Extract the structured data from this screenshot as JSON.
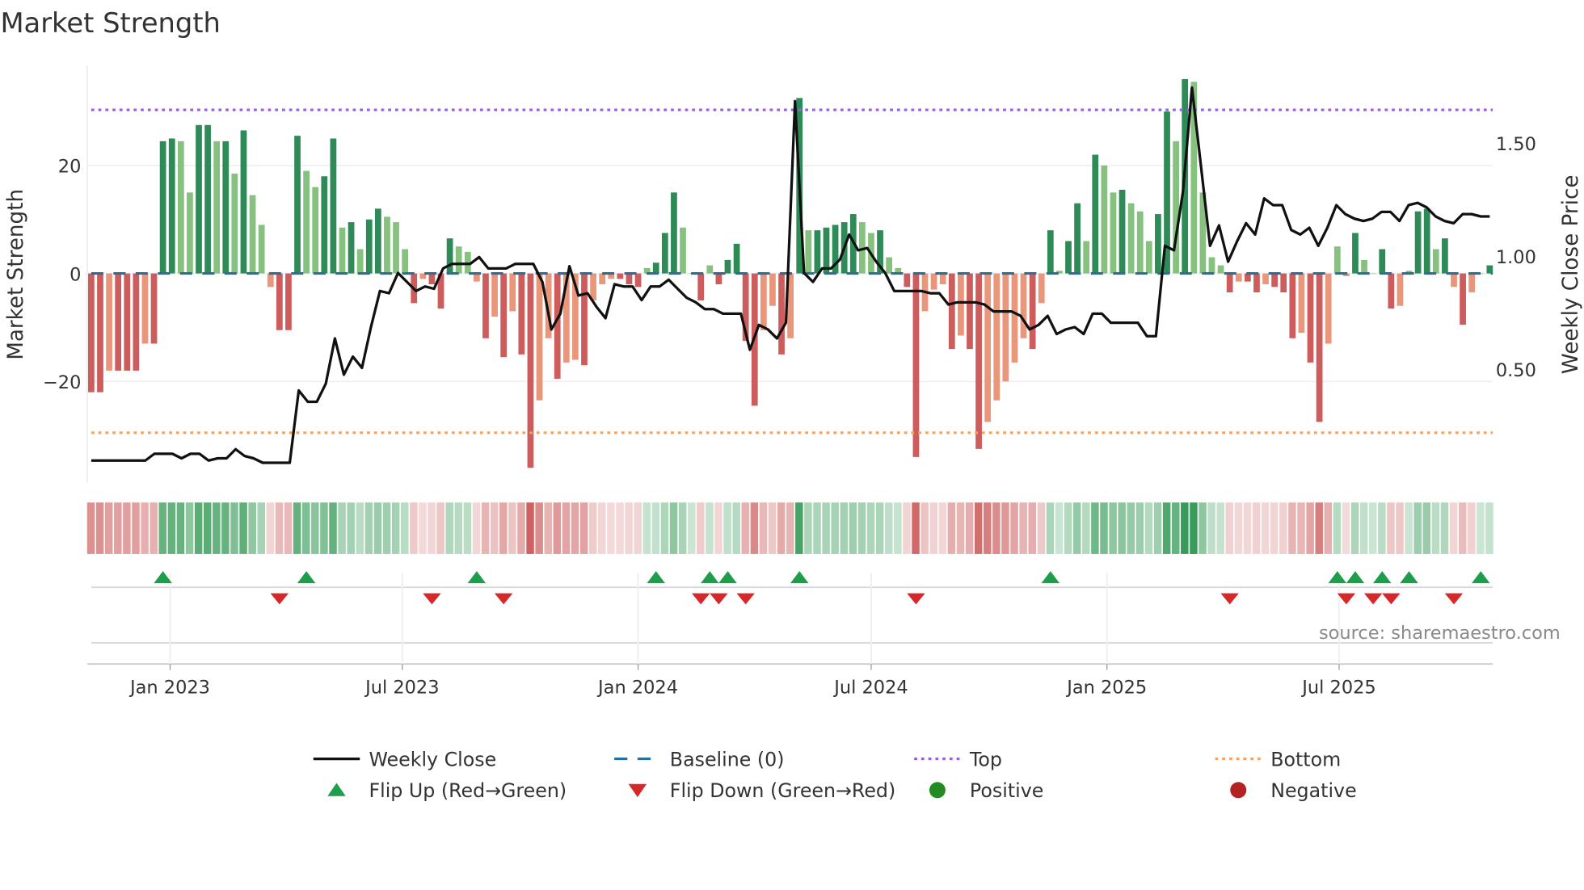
{
  "chart_data": {
    "type": "bar",
    "title": "Market Strength",
    "ylabel": "Market Strength",
    "y2label": "Weekly Close Price",
    "ylim": [
      -37,
      38
    ],
    "y2lim": [
      0.0,
      1.92
    ],
    "yticks": [
      {
        "v": -20,
        "label": "−20"
      },
      {
        "v": 0,
        "label": "0"
      },
      {
        "v": 20,
        "label": "20"
      }
    ],
    "y2ticks": [
      {
        "v": 0.5,
        "label": "0.50"
      },
      {
        "v": 1.0,
        "label": "1.00"
      },
      {
        "v": 1.5,
        "label": "1.50"
      }
    ],
    "week_count": 157,
    "xticks": [
      {
        "week": 8.8,
        "label": "Jan 2023"
      },
      {
        "week": 34.7,
        "label": "Jul 2023"
      },
      {
        "week": 61.0,
        "label": "Jan 2024"
      },
      {
        "week": 87.0,
        "label": "Jul 2024"
      },
      {
        "week": 113.3,
        "label": "Jan 2025"
      },
      {
        "week": 139.2,
        "label": "Jul 2025"
      }
    ],
    "top_level": 30.3,
    "bottom_level": -29.5,
    "baseline": 0,
    "strength": [
      -22,
      -22,
      -18,
      -18,
      -18,
      -18,
      -13,
      -13,
      24.5,
      25,
      24.5,
      15,
      27.5,
      27.5,
      24.5,
      24.5,
      18.5,
      26.5,
      14.5,
      9,
      -2.5,
      -10.5,
      -10.5,
      25.5,
      19,
      16,
      18,
      25,
      8.5,
      9.5,
      4.5,
      10,
      12,
      10.5,
      9.5,
      4.5,
      -5.5,
      -1,
      -2,
      -6.5,
      6.5,
      5,
      4,
      -1.5,
      -12,
      -8,
      -15.5,
      -7,
      -15,
      -36,
      -23.5,
      -12,
      -19.5,
      -16.5,
      -16,
      -17,
      -5,
      -2,
      -1,
      -1,
      -2,
      -2.5,
      1,
      2,
      7.5,
      15,
      8.5,
      0,
      -5,
      1.5,
      -2,
      2.5,
      5.5,
      -12.5,
      -24.5,
      -10.5,
      -6,
      -15,
      -12,
      32.5,
      8,
      8,
      8.5,
      9,
      9.5,
      11,
      9.5,
      7.5,
      8,
      3,
      1,
      -2.5,
      -34,
      -7,
      -3,
      -2,
      -14,
      -11.5,
      -14,
      -32.5,
      -27.5,
      -23.5,
      -20,
      -16.5,
      -12,
      -14,
      -5.5,
      8,
      0.5,
      6,
      13,
      6,
      22,
      20,
      15,
      15.5,
      13,
      11.5,
      6,
      11,
      30,
      24.5,
      36,
      35.5,
      15,
      3,
      1.5,
      -3.5,
      -1.5,
      -1.5,
      -3.5,
      -2,
      -2.5,
      -3.5,
      -12,
      -11,
      -16.5,
      -27.5,
      -13,
      5,
      -0.5,
      7.5,
      2.5,
      0,
      4.5,
      -6.5,
      -6,
      0.5,
      11.5,
      12,
      4.5,
      6.5,
      -2.5,
      -9.5,
      -3.5,
      0,
      1.5
    ],
    "weekly_close": [
      0.15,
      0.15,
      0.15,
      0.15,
      0.15,
      0.15,
      0.15,
      0.18,
      0.18,
      0.18,
      0.16,
      0.18,
      0.18,
      0.15,
      0.16,
      0.16,
      0.2,
      0.17,
      0.16,
      0.14,
      0.14,
      0.14,
      0.14,
      0.46,
      0.41,
      0.41,
      0.49,
      0.69,
      0.53,
      0.61,
      0.56,
      0.74,
      0.9,
      0.89,
      0.98,
      0.94,
      0.9,
      0.92,
      0.91,
      1.0,
      1.02,
      1.02,
      1.02,
      1.05,
      1.0,
      1.0,
      1.0,
      1.02,
      1.02,
      1.02,
      0.94,
      0.73,
      0.8,
      1.01,
      0.88,
      0.89,
      0.83,
      0.78,
      0.93,
      0.92,
      0.92,
      0.86,
      0.92,
      0.92,
      0.95,
      0.91,
      0.87,
      0.85,
      0.82,
      0.82,
      0.8,
      0.8,
      0.8,
      0.64,
      0.75,
      0.73,
      0.69,
      0.76,
      1.74,
      0.98,
      0.94,
      1.0,
      1.0,
      1.04,
      1.15,
      1.08,
      1.09,
      1.03,
      0.98,
      0.9,
      0.9,
      0.9,
      0.9,
      0.89,
      0.89,
      0.84,
      0.85,
      0.85,
      0.85,
      0.84,
      0.81,
      0.81,
      0.81,
      0.79,
      0.73,
      0.75,
      0.79,
      0.71,
      0.73,
      0.74,
      0.71,
      0.8,
      0.8,
      0.76,
      0.76,
      0.76,
      0.76,
      0.7,
      0.7,
      1.1,
      1.08,
      1.34,
      1.8,
      1.45,
      1.1,
      1.19,
      1.03,
      1.12,
      1.2,
      1.15,
      1.31,
      1.28,
      1.28,
      1.17,
      1.15,
      1.18,
      1.1,
      1.18,
      1.28,
      1.24,
      1.22,
      1.21,
      1.22,
      1.25,
      1.25,
      1.21,
      1.28,
      1.29,
      1.27,
      1.23,
      1.21,
      1.2,
      1.24,
      1.24,
      1.23,
      1.23
    ],
    "flip_up_weeks": [
      8,
      24,
      43,
      63,
      69,
      71,
      79,
      107,
      139,
      141,
      144,
      147,
      155
    ],
    "flip_down_weeks": [
      21,
      38,
      46,
      68,
      70,
      73,
      92,
      127,
      140,
      143,
      145,
      152
    ],
    "legend": [
      {
        "label": "Weekly Close",
        "kind": "line",
        "color": "#111111"
      },
      {
        "label": "Baseline (0)",
        "kind": "dash",
        "color": "#2a6f97"
      },
      {
        "label": "Top",
        "kind": "dot",
        "color": "#9b5de5"
      },
      {
        "label": "Bottom",
        "kind": "dot",
        "color": "#f4a261"
      },
      {
        "label": "Flip Up (Red→Green)",
        "kind": "tri-up",
        "color": "#1e9e4a"
      },
      {
        "label": "Flip Down (Green→Red)",
        "kind": "tri-down",
        "color": "#d62828"
      },
      {
        "label": "Positive",
        "kind": "circle",
        "color": "#228b22"
      },
      {
        "label": "Negative",
        "kind": "circle",
        "color": "#b22222"
      }
    ],
    "legend_placement": "bottom",
    "annotation": "source: sharemaestro.com",
    "colors": {
      "pos_dark": "#2e8b57",
      "pos_light": "#86c17f",
      "neg_dark": "#cd5c5c",
      "neg_light": "#e9967a"
    }
  }
}
